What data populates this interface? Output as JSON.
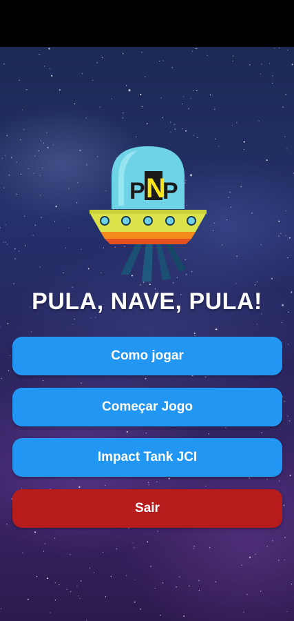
{
  "game": {
    "logo_text": "PNP",
    "title": "PULA, NAVE, PULA!"
  },
  "menu": {
    "how_to_play": "Como jogar",
    "start_game": "Começar Jogo",
    "impact_tank": "Impact Tank JCI",
    "exit": "Sair"
  },
  "colors": {
    "button_primary": "#2196f3",
    "button_exit": "#b71c1c",
    "title_text": "#ffffff"
  }
}
